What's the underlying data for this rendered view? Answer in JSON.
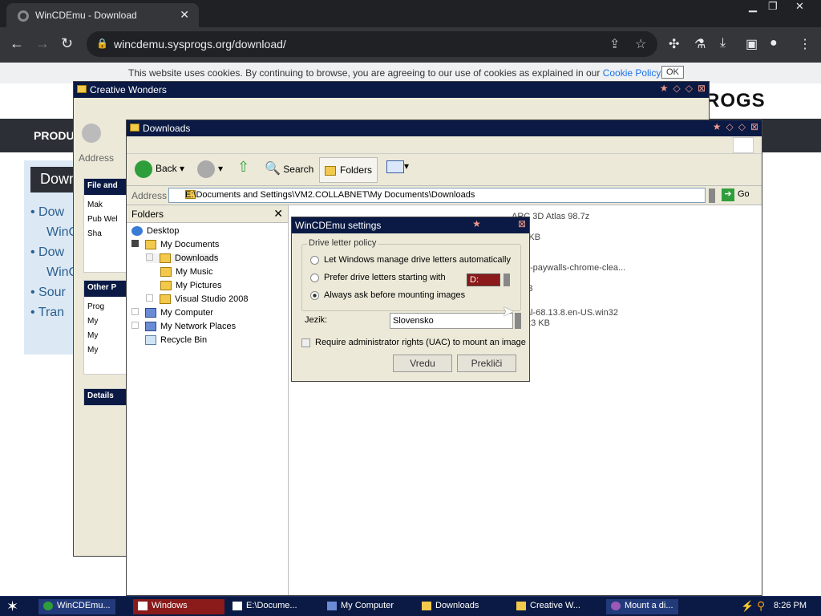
{
  "browser": {
    "tab_title": "WinCDEmu - Download",
    "url": "wincdemu.sysprogs.org/download/"
  },
  "page": {
    "cookie_text": "This website uses cookies. By continuing to browse, you are agreeing to our use of cookies as explained in our",
    "cookie_link": "Cookie Policy.",
    "cookie_ok": "OK",
    "brand": "ROGS",
    "nav_item": "PRODU",
    "download_heading": "Down",
    "list_items": [
      "Dow",
      "WinC",
      "Dow",
      "WinC",
      "Sour",
      "Tran"
    ]
  },
  "creative_window": {
    "title": "Creative Wonders",
    "address_label": "Address",
    "panel1_title": "File and",
    "panel1_items": [
      "Mak",
      "Pub Wel",
      "Sha"
    ],
    "panel2_title": "Other P",
    "panel2_items": [
      "Prog",
      "My",
      "My",
      "My"
    ],
    "panel3_title": "Details"
  },
  "downloads_window": {
    "title": "Downloads",
    "toolbar": {
      "back": "Back",
      "search": "Search",
      "folders": "Folders"
    },
    "address_label": "Address",
    "address_value": "E:\\Documents and Settings\\VM2.COLLABNET\\My Documents\\Downloads",
    "go_label": "Go",
    "folders_header": "Folders",
    "tree": [
      "Desktop",
      "My Documents",
      "Downloads",
      "My Music",
      "My Pictures",
      "Visual Studio 2008",
      "My Computer",
      "My Network Places",
      "Recycle Bin"
    ],
    "files": [
      {
        "name": "ARC 3D Atlas 98.7z",
        "line2": "e",
        "line3": "996 KB"
      },
      {
        "name": "ss-paywalls-chrome-clea...",
        "line2": "",
        "line3": "KB"
      },
      {
        "name": "al-68.13.8.en-US.win32",
        "line2": "",
        "line3": "23 KB"
      }
    ]
  },
  "dialog": {
    "title": "WinCDEmu settings",
    "group_label": "Drive letter policy",
    "option1": "Let Windows manage drive letters automatically",
    "option2": "Prefer drive letters starting with",
    "option3": "Always ask before mounting images",
    "selected_option": 3,
    "drive_value": "D:",
    "language_label": "Jezik:",
    "language_value": "Slovensko",
    "uac_label": "Require administrator rights (UAC) to mount an image",
    "ok_label": "Vredu",
    "cancel_label": "Prekliči"
  },
  "taskbar": {
    "items": [
      "WinCDEmu...",
      "Windows",
      "E:\\Docume...",
      "My Computer",
      "Downloads",
      "Creative W...",
      "Mount a di..."
    ],
    "time": "8:26 PM"
  }
}
